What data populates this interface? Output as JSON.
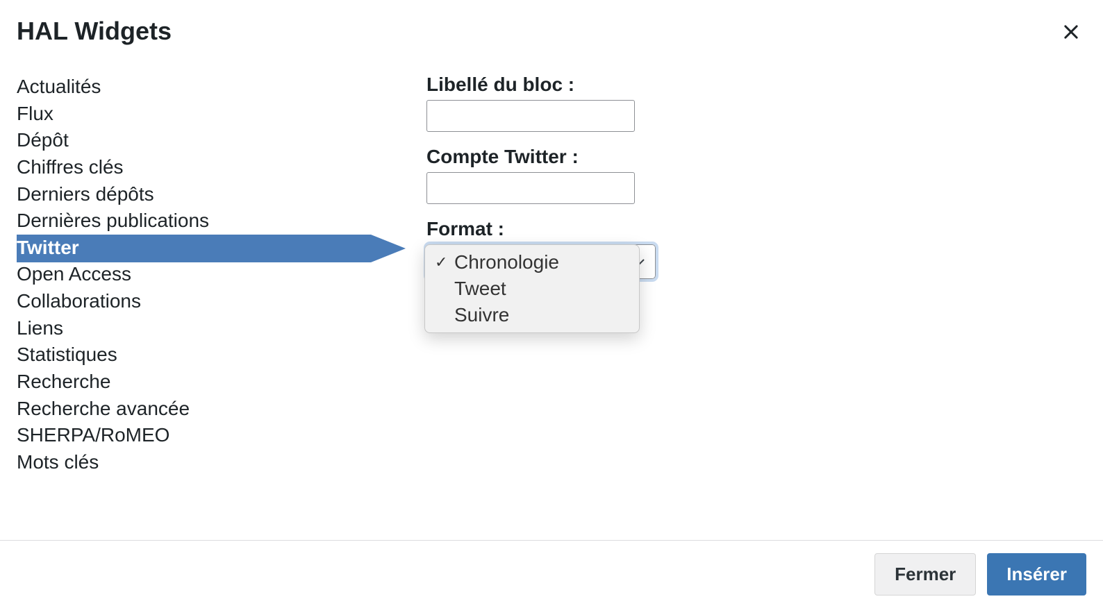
{
  "modal": {
    "title": "HAL Widgets",
    "close_label": "Fermer"
  },
  "sidebar": {
    "items": [
      {
        "label": "Actualités"
      },
      {
        "label": "Flux"
      },
      {
        "label": "Dépôt"
      },
      {
        "label": "Chiffres clés"
      },
      {
        "label": "Derniers dépôts"
      },
      {
        "label": "Dernières publications"
      },
      {
        "label": "Twitter",
        "active": true
      },
      {
        "label": "Open Access"
      },
      {
        "label": "Collaborations"
      },
      {
        "label": "Liens"
      },
      {
        "label": "Statistiques"
      },
      {
        "label": "Recherche"
      },
      {
        "label": "Recherche avancée"
      },
      {
        "label": "SHERPA/RoMEO"
      },
      {
        "label": "Mots clés"
      }
    ]
  },
  "form": {
    "block_label": "Libellé du bloc :",
    "block_value": "",
    "twitter_label": "Compte Twitter :",
    "twitter_value": "",
    "format_label": "Format :",
    "format_options": [
      {
        "label": "Chronologie",
        "selected": true
      },
      {
        "label": "Tweet"
      },
      {
        "label": "Suivre"
      }
    ]
  },
  "footer": {
    "cancel": "Fermer",
    "insert": "Insérer"
  },
  "colors": {
    "primary": "#3b76b3",
    "arrow": "#4a7cb8"
  }
}
